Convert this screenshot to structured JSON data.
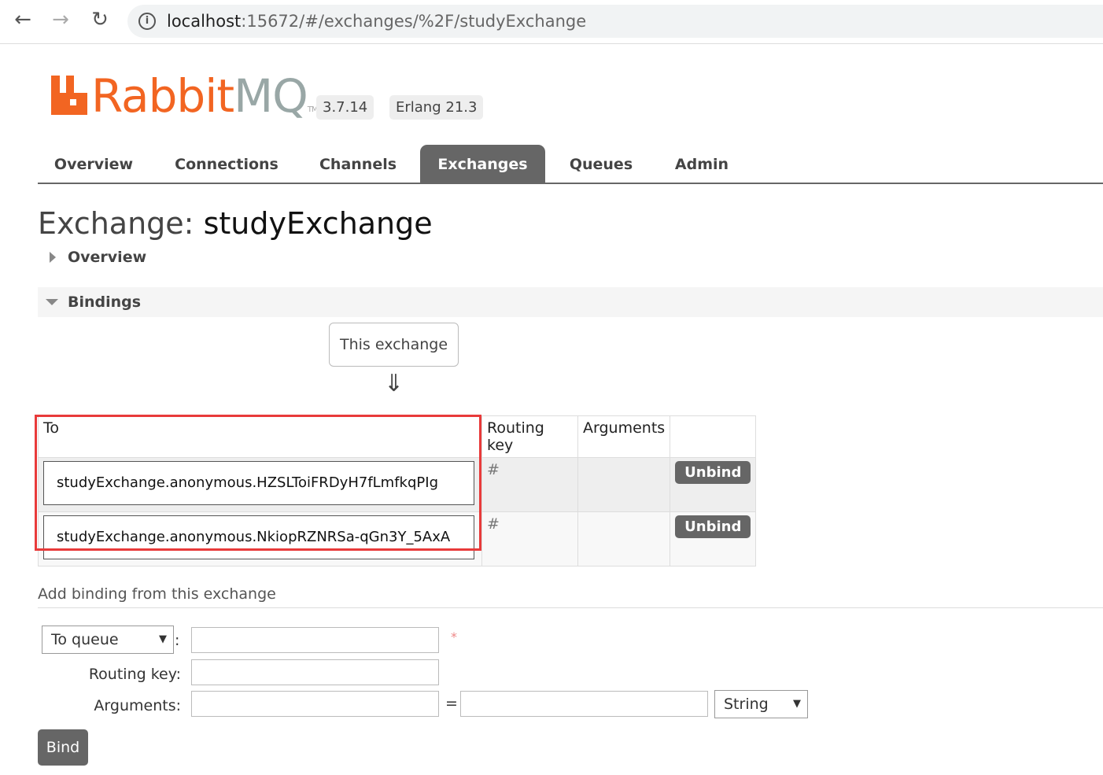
{
  "browser": {
    "url_host": "localhost",
    "url_rest": ":15672/#/exchanges/%2F/studyExchange"
  },
  "header": {
    "logo_primary": "Rabbit",
    "logo_secondary": "MQ",
    "logo_tm": "TM",
    "version": "3.7.14",
    "erlang": "Erlang 21.3"
  },
  "tabs": [
    {
      "label": "Overview"
    },
    {
      "label": "Connections"
    },
    {
      "label": "Channels"
    },
    {
      "label": "Exchanges",
      "active": true
    },
    {
      "label": "Queues"
    },
    {
      "label": "Admin"
    }
  ],
  "page": {
    "title_prefix": "Exchange:",
    "title_name": "studyExchange",
    "overview_section": "Overview",
    "bindings_section": "Bindings",
    "this_exchange": "This exchange",
    "down_arrow": "⇓"
  },
  "bindings": {
    "headers": [
      "To",
      "Routing key",
      "Arguments",
      ""
    ],
    "rows": [
      {
        "to": "studyExchange.anonymous.HZSLToiFRDyH7fLmfkqPIg",
        "routing_key": "#",
        "arguments": "",
        "action": "Unbind"
      },
      {
        "to": "studyExchange.anonymous.NkiopRZNRSa-qGn3Y_5AxA",
        "routing_key": "#",
        "arguments": "",
        "action": "Unbind"
      }
    ]
  },
  "add_binding": {
    "title": "Add binding from this exchange",
    "destination_type": "To queue",
    "colon": ":",
    "required_mark": "*",
    "routing_key_label": "Routing key:",
    "arguments_label": "Arguments:",
    "equals": "=",
    "arg_type": "String",
    "bind_label": "Bind"
  },
  "colors": {
    "brand_orange": "#f26522",
    "tab_active": "#666666",
    "highlight": "#e83a3a"
  }
}
